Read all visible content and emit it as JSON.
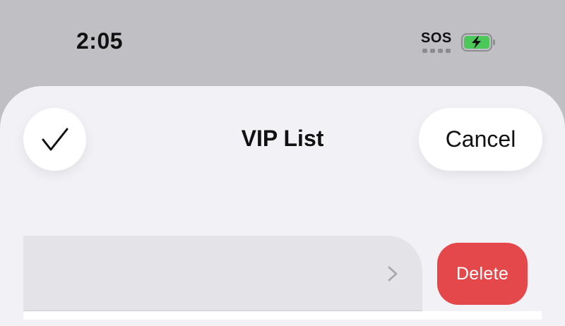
{
  "status_bar": {
    "time": "2:05",
    "sos_label": "SOS",
    "battery_icon": "battery-charging-icon",
    "battery_color": "#4cc85a"
  },
  "header": {
    "title": "VIP List",
    "cancel_label": "Cancel",
    "done_icon": "checkmark-icon"
  },
  "list": {
    "row_chevron_icon": "chevron-right-icon",
    "delete_label": "Delete",
    "delete_color": "#e5484a"
  }
}
